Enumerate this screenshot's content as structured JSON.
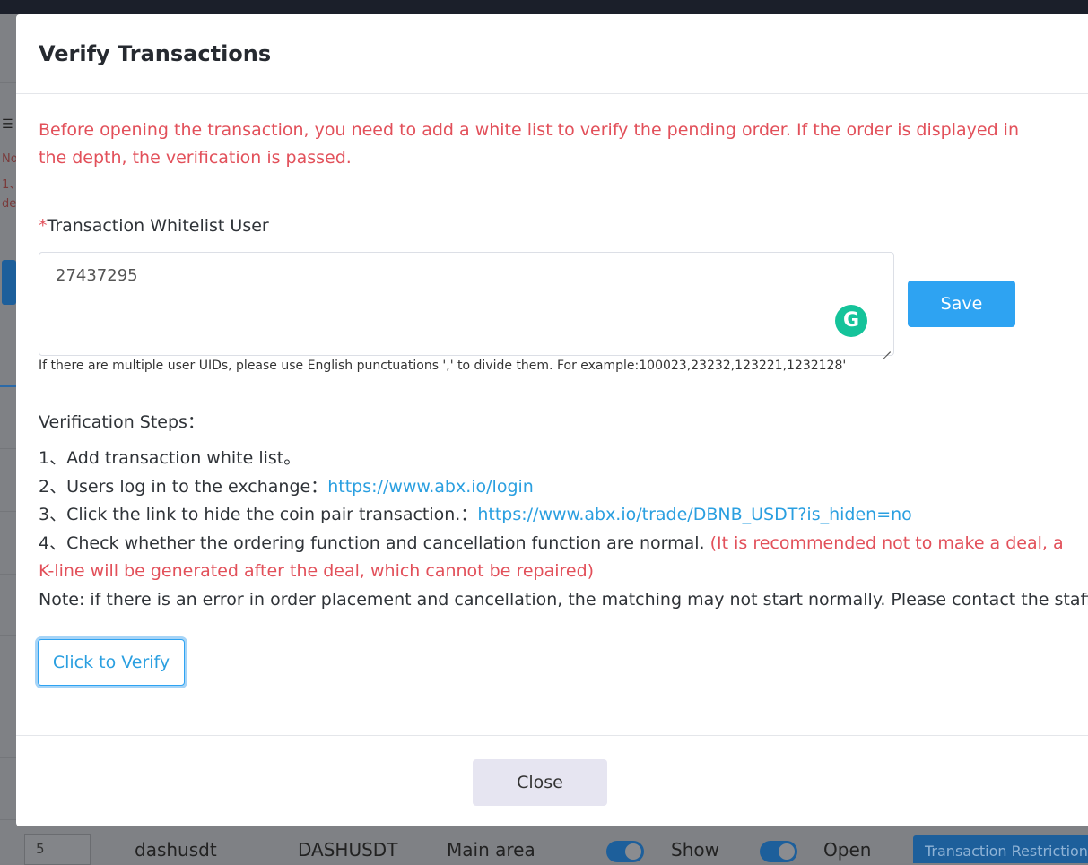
{
  "background": {
    "side_text": [
      "No",
      "1、",
      "de"
    ],
    "row": {
      "index_value": "5",
      "symbol": "dashusdt",
      "pair": "DASHUSDT",
      "area": "Main area",
      "show_label": "Show",
      "open_label": "Open",
      "restriction_label": "Transaction Restriction"
    }
  },
  "modal": {
    "title": "Verify Transactions",
    "warning": "Before opening the transaction, you need to add a white list to verify the pending order. If the order is displayed in the depth, the verification is passed.",
    "whitelist": {
      "required_mark": "*",
      "label": "Transaction Whitelist User",
      "value": "27437295",
      "hint": "If there are multiple user UIDs, please use English punctuations ',' to divide them. For example:100023,23232,123221,1232128'",
      "save_label": "Save"
    },
    "steps_title": "Verification Steps：",
    "steps": {
      "s1": "1、Add transaction white list。",
      "s2_text": "2、Users log in to the exchange：",
      "s2_link": "https://www.abx.io/login",
      "s3_text": "3、Click the link to hide the coin pair transaction.：",
      "s3_link": "https://www.abx.io/trade/DBNB_USDT?is_hiden=no",
      "s4_text": "4、Check whether the ordering function and cancellation function are normal. ",
      "s4_warning": "(It is recommended not to make a deal, a K-line will be generated after the deal, which cannot be repaired)",
      "note": "Note: if there is an error in order placement and cancellation, the matching may not start normally. Please contact the staff."
    },
    "verify_label": "Click to Verify",
    "close_label": "Close"
  },
  "colors": {
    "accent": "#2ea3f2",
    "warning": "#e2505a",
    "link": "#2a9fe0",
    "grammarly": "#15c39a"
  }
}
